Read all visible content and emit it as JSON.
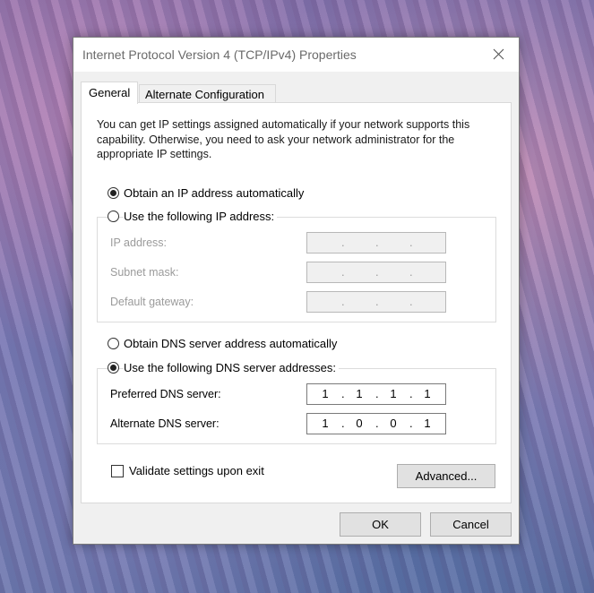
{
  "window": {
    "title": "Internet Protocol Version 4 (TCP/IPv4) Properties",
    "close_icon": "close-icon"
  },
  "tabs": [
    {
      "label": "General",
      "active": true
    },
    {
      "label": "Alternate Configuration",
      "active": false
    }
  ],
  "general": {
    "intro": "You can get IP settings assigned automatically if your network supports this capability. Otherwise, you need to ask your network administrator for the appropriate IP settings.",
    "ip_mode": {
      "auto_label": "Obtain an IP address automatically",
      "manual_label": "Use the following IP address:",
      "selected": "auto"
    },
    "ip_fields": {
      "ip_address_label": "IP address:",
      "subnet_mask_label": "Subnet mask:",
      "default_gateway_label": "Default gateway:"
    },
    "dns_mode": {
      "auto_label": "Obtain DNS server address automatically",
      "manual_label": "Use the following DNS server addresses:",
      "selected": "manual"
    },
    "dns_fields": {
      "preferred_label": "Preferred DNS server:",
      "preferred_octets": [
        "1",
        "1",
        "1",
        "1"
      ],
      "alternate_label": "Alternate DNS server:",
      "alternate_octets": [
        "1",
        "0",
        "0",
        "1"
      ]
    },
    "validate_label": "Validate settings upon exit",
    "validate_checked": false,
    "advanced_label": "Advanced..."
  },
  "footer": {
    "ok_label": "OK",
    "cancel_label": "Cancel"
  }
}
